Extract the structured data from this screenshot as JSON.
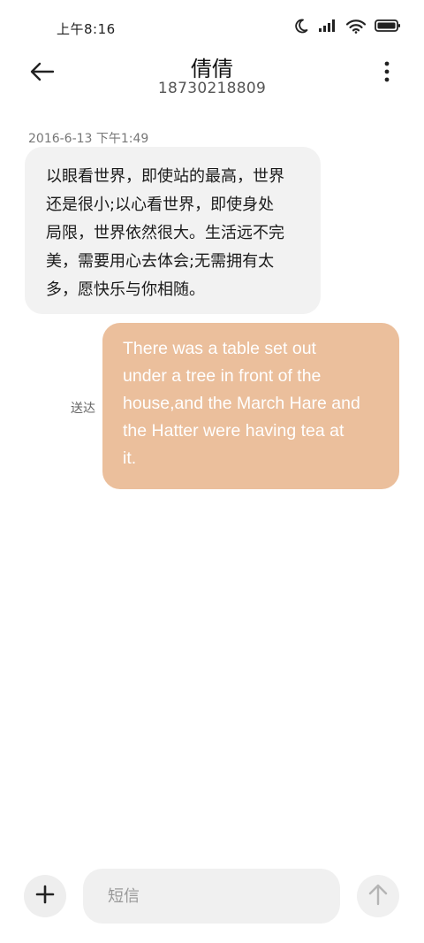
{
  "status_bar": {
    "time": "上午8:16",
    "icons": [
      "moon-icon",
      "signal-icon",
      "wifi-icon",
      "battery-icon"
    ]
  },
  "header": {
    "back_icon": "arrow-left-icon",
    "contact_name": "倩倩",
    "contact_number": "18730218809",
    "more_icon": "more-vertical-icon"
  },
  "conversation": {
    "timestamp": "2016-6-13 下午1:49",
    "messages": [
      {
        "direction": "incoming",
        "lines": [
          "以眼看世界，即使站的最高，世界",
          "还是很小;以心看世界，即使身处",
          "局限，世界依然很大。生活远不完",
          "美，需要用心去体会;无需拥有太",
          "多，愿快乐与你相随。"
        ]
      },
      {
        "direction": "outgoing",
        "status": "送达",
        "lines": [
          "There was a table set out",
          "under a tree in front of the",
          "house,and the March Hare and",
          "the Hatter were having tea at",
          "it."
        ]
      }
    ]
  },
  "composer": {
    "add_icon": "plus-icon",
    "placeholder": "短信",
    "value": "",
    "send_icon": "arrow-up-icon"
  },
  "colors": {
    "incoming_bubble": "#f2f2f2",
    "outgoing_bubble": "#ebbf9c",
    "outgoing_text": "#ffffff",
    "background": "#ffffff"
  }
}
